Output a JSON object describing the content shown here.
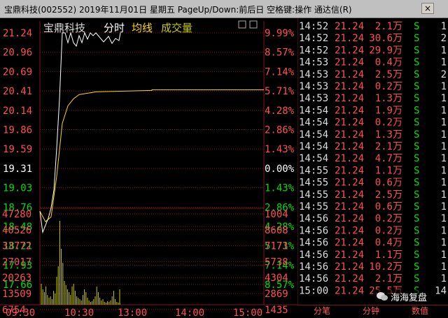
{
  "window": {
    "title": "宝鼎科技(002552)  2019年11月01日  星期五  PageUp/Down:前后日  空格键:操作  通达信(R)",
    "close_label": "×"
  },
  "chart": {
    "stock_name": "宝鼎科技",
    "mode_label": "分时",
    "avg_label": "均线",
    "vol_label": "成交量",
    "price_ticks": [
      "21.24",
      "20.96",
      "20.69",
      "20.41",
      "20.14",
      "19.86",
      "19.59",
      "19.31",
      "19.03",
      "18.76",
      "18.48",
      "18.21",
      "17.93",
      "17.66"
    ],
    "pct_ticks": [
      "9.99%",
      "8.57%",
      "7.14%",
      "5.71%",
      "4.28%",
      "2.86%",
      "1.43%",
      "0.00%",
      "1.43%",
      "2.86%",
      "4.28%",
      "5.71%",
      "7.14%",
      "8.57%"
    ],
    "vol_ticks_left": [
      "47280",
      "40526",
      "33772",
      "27017",
      "20263",
      "13509",
      "6754"
    ],
    "vol_ticks_right": [
      "1004",
      "8608",
      "7173",
      "5738",
      "4304",
      "2869",
      "1435"
    ],
    "time_labels": [
      "09:30",
      "10:30",
      "13:00",
      "14:00",
      "15:00"
    ],
    "colors": {
      "up": "#ff5050",
      "down": "#00e000",
      "flat": "#ffffff",
      "avg": "#ffd700",
      "volume": "#c8c800",
      "grid": "#7a1a1a"
    }
  },
  "chart_data": {
    "type": "line",
    "title": "宝鼎科技 分时",
    "series": [
      {
        "name": "分时",
        "x": [
          "09:30",
          "09:33",
          "09:36",
          "09:39",
          "09:42",
          "09:45",
          "09:48",
          "09:51",
          "09:54",
          "09:57",
          "10:00",
          "10:03",
          "10:06",
          "10:09",
          "10:12",
          "10:15",
          "10:18",
          "10:21",
          "10:24",
          "10:27",
          "10:30"
        ],
        "values": [
          18.7,
          18.4,
          18.5,
          18.6,
          18.75,
          19.0,
          19.6,
          20.3,
          21.24,
          21.24,
          21.1,
          21.24,
          21.1,
          21.05,
          21.2,
          21.1,
          21.24,
          21.15,
          21.24,
          21.2,
          21.24
        ]
      },
      {
        "name": "均线",
        "x": [
          "09:30",
          "09:36",
          "09:42",
          "09:48",
          "09:54",
          "10:00",
          "10:06",
          "10:12",
          "10:30",
          "11:30",
          "13:00",
          "14:00",
          "15:00"
        ],
        "values": [
          18.7,
          18.55,
          18.62,
          19.2,
          19.95,
          20.2,
          20.3,
          20.36,
          20.4,
          20.42,
          20.43,
          20.43,
          20.43
        ]
      }
    ],
    "ylim": [
      17.52,
      21.24
    ]
  },
  "ticks": {
    "rows": [
      {
        "time": "14:52",
        "price": "21.24",
        "vol": "2.1万",
        "side": "S",
        "n": "1"
      },
      {
        "time": "14:52",
        "price": "21.24",
        "vol": "30.6万",
        "side": "S",
        "n": "2"
      },
      {
        "time": "14:52",
        "price": "21.24",
        "vol": "29.9万",
        "side": "S",
        "n": "1"
      },
      {
        "time": "14:53",
        "price": "21.24",
        "vol": "0.4万",
        "side": "S",
        "n": "1"
      },
      {
        "time": "14:53",
        "price": "21.24",
        "vol": "2.5万",
        "side": "S",
        "n": "2"
      },
      {
        "time": "14:53",
        "price": "21.24",
        "vol": "0.2万",
        "side": "S",
        "n": "1"
      },
      {
        "time": "14:53",
        "price": "21.24",
        "vol": "1.3万",
        "side": "S",
        "n": "1"
      },
      {
        "time": "14:54",
        "price": "21.24",
        "vol": "1.9万",
        "side": "S",
        "n": "1"
      },
      {
        "time": "14:54",
        "price": "21.24",
        "vol": "0.2万",
        "side": "S",
        "n": "1"
      },
      {
        "time": "14:54",
        "price": "21.24",
        "vol": "1.3万",
        "side": "S",
        "n": "1"
      },
      {
        "time": "14:54",
        "price": "21.24",
        "vol": "2.1万",
        "side": "S",
        "n": "1"
      },
      {
        "time": "14:54",
        "price": "21.24",
        "vol": "4.7万",
        "side": "S",
        "n": "1"
      },
      {
        "time": "14:55",
        "price": "21.24",
        "vol": "1.1万",
        "side": "S",
        "n": "1"
      },
      {
        "time": "14:55",
        "price": "21.24",
        "vol": "0.6万",
        "side": "S",
        "n": "1"
      },
      {
        "time": "14:55",
        "price": "21.24",
        "vol": "2.5万",
        "side": "S",
        "n": "1"
      },
      {
        "time": "14:55",
        "price": "21.24",
        "vol": "0.6万",
        "side": "S",
        "n": "1"
      },
      {
        "time": "14:56",
        "price": "21.24",
        "vol": "0.2万",
        "side": "S",
        "n": "1"
      },
      {
        "time": "14:56",
        "price": "21.24",
        "vol": "0.2万",
        "side": "S",
        "n": "1"
      },
      {
        "time": "14:56",
        "price": "21.24",
        "vol": "0.4万",
        "side": "S",
        "n": "1"
      },
      {
        "time": "14:56",
        "price": "21.24",
        "vol": "1.1万",
        "side": "S",
        "n": "1"
      },
      {
        "time": "14:56",
        "price": "21.24",
        "vol": "10.2万",
        "side": "S",
        "n": "1"
      },
      {
        "time": "14:56",
        "price": "21.24",
        "vol": "2.1万",
        "side": "S",
        "n": "1"
      },
      {
        "time": "15:00",
        "price": "21.24",
        "vol": "25.5万",
        "side": "S",
        "n": "14"
      }
    ]
  },
  "tabs": {
    "fenbi": "分笔",
    "fenzhong": "分钟",
    "shuzhi": "数值"
  },
  "watermark": {
    "text": "海海复盘",
    "icon": "wechat-icon"
  }
}
